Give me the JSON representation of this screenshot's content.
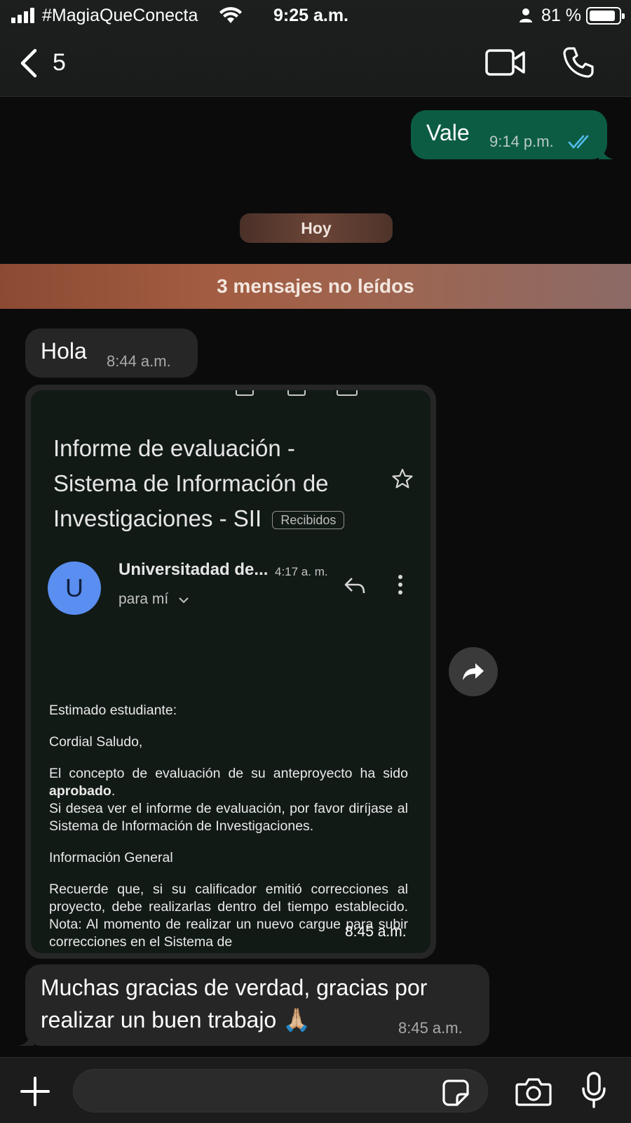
{
  "status_bar": {
    "carrier": "#MagiaQueConecta",
    "time": "9:25 a.m.",
    "battery": "81 %"
  },
  "header": {
    "back_count": "5",
    "icons": [
      "back-chevron-icon",
      "video-call-icon",
      "voice-call-icon"
    ]
  },
  "messages": {
    "outgoing_vale": {
      "text": "Vale",
      "time": "9:14 p.m."
    },
    "date_chip": "Hoy",
    "unread_banner": "3 mensajes no leídos",
    "hola": {
      "text": "Hola",
      "time": "8:44 a.m."
    },
    "email_screenshot": {
      "subject": "Informe de evaluación - Sistema de Información de Investigaciones - SII",
      "label": "Recibidos",
      "avatar_letter": "U",
      "sender": "Universitadad de...",
      "sender_time": "4:17 a. m.",
      "recipient": "para mí",
      "greeting": "Estimado estudiante:",
      "salutation": "Cordial Saludo,",
      "p1_before": "El concepto de evaluación de su anteproyecto ha sido ",
      "p1_bold": "aprobado",
      "p1_after": ".",
      "p2": "Si desea ver el informe de evaluación, por favor diríjase al Sistema de Información de Investigaciones.",
      "section_title": "Información General",
      "p3": "Recuerde que, si su calificador emitió correcciones al proyecto, debe realizarlas dentro del tiempo establecido. Nota: Al momento de realizar un nuevo cargue para subir correcciones en el Sistema de",
      "time": "8:45 a.m."
    },
    "gracias": {
      "text": "Muchas gracias de verdad, gracias por realizar un buen trabajo 🙏🏼",
      "time": "8:45 a.m."
    }
  },
  "input_bar": {
    "placeholder": "",
    "icons": [
      "plus-icon",
      "sticker-icon",
      "camera-icon",
      "microphone-icon"
    ]
  },
  "colors": {
    "outgoing_bubble": "#0c5c44",
    "incoming_bubble": "#262626",
    "read_checks": "#53bdeb",
    "unread_banner": "#a35d42"
  }
}
